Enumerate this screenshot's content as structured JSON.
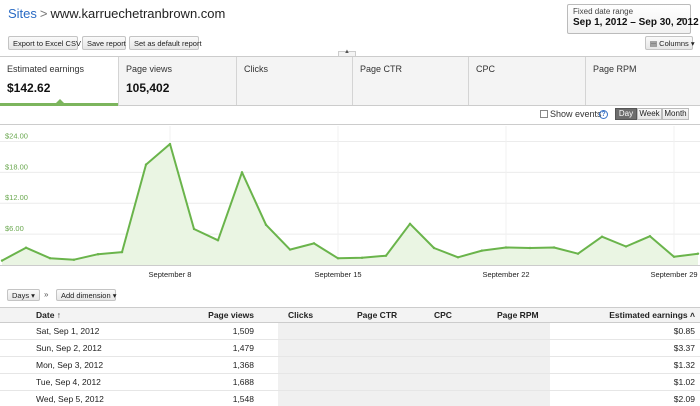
{
  "header": {
    "breadcrumb_root": "Sites",
    "breadcrumb_sep": ">",
    "site": "www.karruechetranbrown.com"
  },
  "date_range": {
    "label": "Fixed date range",
    "value": "Sep 1, 2012 – Sep 30, 2012",
    "arrow": "▼"
  },
  "toolbar": {
    "export_label": "Export to Excel CSV",
    "save_label": "Save report",
    "default_label": "Set as default report",
    "columns_label": "▤ Columns ▾"
  },
  "metrics": [
    {
      "label": "Estimated earnings",
      "value": "$142.62"
    },
    {
      "label": "Page views",
      "value": "105,402"
    },
    {
      "label": "Clicks",
      "value": ""
    },
    {
      "label": "Page CTR",
      "value": ""
    },
    {
      "label": "CPC",
      "value": ""
    },
    {
      "label": "Page RPM",
      "value": ""
    }
  ],
  "chart_controls": {
    "show_events": "Show events",
    "help": "?",
    "day": "Day",
    "week": "Week",
    "month": "Month"
  },
  "chart_data": {
    "type": "area",
    "ylim": [
      0,
      27
    ],
    "y_ticks": [
      "$24.00",
      "$18.00",
      "$12.00",
      "$6.00"
    ],
    "y_tick_values": [
      24,
      18,
      12,
      6
    ],
    "x_ticks": [
      "September 8",
      "September 15",
      "September 22",
      "September 29"
    ],
    "x_tick_days": [
      8,
      15,
      22,
      29
    ],
    "x": [
      1,
      2,
      3,
      4,
      5,
      6,
      7,
      8,
      9,
      10,
      11,
      12,
      13,
      14,
      15,
      16,
      17,
      18,
      19,
      20,
      21,
      22,
      23,
      24,
      25,
      26,
      27,
      28,
      29,
      30
    ],
    "values": [
      0.85,
      3.37,
      1.32,
      1.02,
      2.09,
      2.5,
      19.5,
      23.5,
      7.0,
      4.8,
      18.0,
      7.8,
      3.0,
      4.2,
      1.3,
      1.4,
      1.8,
      8.0,
      3.3,
      1.5,
      2.8,
      3.4,
      3.3,
      3.4,
      2.2,
      5.5,
      3.6,
      5.6,
      1.6,
      2.2
    ],
    "line_color": "#6ab44b",
    "fill_color": "#eaf5e3"
  },
  "table_controls": {
    "days": "Days ▾",
    "chevron": "»",
    "add_dimension": "Add dimension ▾"
  },
  "table": {
    "headers": {
      "date": "Date ↑",
      "page_views": "Page views",
      "clicks": "Clicks",
      "page_ctr": "Page CTR",
      "cpc": "CPC",
      "page_rpm": "Page RPM",
      "earnings": "Estimated earnings ˄"
    },
    "rows": [
      {
        "date": "Sat, Sep 1, 2012",
        "page_views": "1,509",
        "earnings": "$0.85"
      },
      {
        "date": "Sun, Sep 2, 2012",
        "page_views": "1,479",
        "earnings": "$3.37"
      },
      {
        "date": "Mon, Sep 3, 2012",
        "page_views": "1,368",
        "earnings": "$1.32"
      },
      {
        "date": "Tue, Sep 4, 2012",
        "page_views": "1,688",
        "earnings": "$1.02"
      },
      {
        "date": "Wed, Sep 5, 2012",
        "page_views": "1,548",
        "earnings": "$2.09"
      }
    ]
  }
}
